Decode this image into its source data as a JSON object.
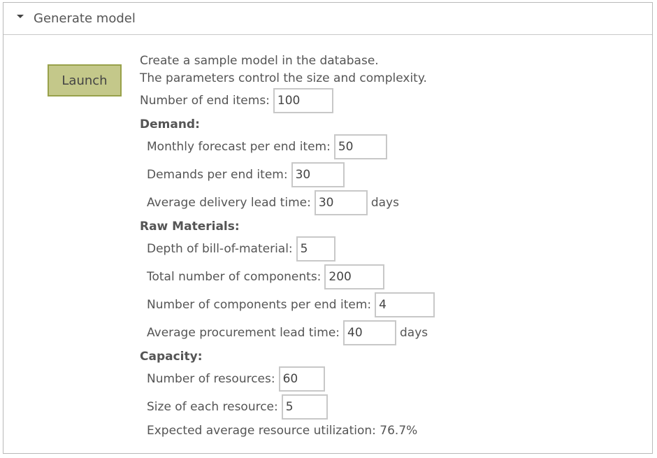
{
  "panel": {
    "title": "Generate model",
    "launch_label": "Launch"
  },
  "intro": {
    "line1": "Create a sample model in the database.",
    "line2": "The parameters control the size and complexity."
  },
  "end_items": {
    "label": "Number of end items:",
    "value": "100"
  },
  "demand": {
    "heading": "Demand:",
    "monthly_forecast_label": "Monthly forecast per end item:",
    "monthly_forecast_value": "50",
    "demands_label": "Demands per end item:",
    "demands_value": "30",
    "lead_time_label": "Average delivery lead time:",
    "lead_time_value": "30",
    "lead_time_unit": "days"
  },
  "raw_materials": {
    "heading": "Raw Materials:",
    "depth_label": "Depth of bill-of-material:",
    "depth_value": "5",
    "total_components_label": "Total number of components:",
    "total_components_value": "200",
    "components_per_item_label": "Number of components per end item:",
    "components_per_item_value": "4",
    "procurement_label": "Average procurement lead time:",
    "procurement_value": "40",
    "procurement_unit": "days"
  },
  "capacity": {
    "heading": "Capacity:",
    "resources_label": "Number of resources:",
    "resources_value": "60",
    "size_label": "Size of each resource:",
    "size_value": "5",
    "utilization_text": "Expected average resource utilization: 76.7%"
  }
}
